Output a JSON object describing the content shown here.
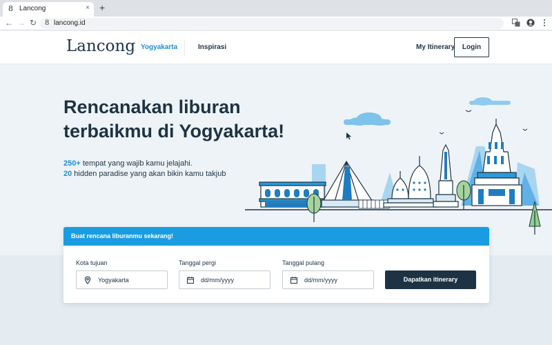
{
  "browser": {
    "tab_title": "Lancong",
    "tab_favicon": "8",
    "tab_close": "×",
    "new_tab": "+",
    "url": "lancong.id",
    "url_icon": "8",
    "back_icon": "←",
    "forward_icon": "→",
    "reload_icon": "↻",
    "extension_icons": [
      "translate-icon",
      "profile-avatar-icon",
      "more-vertical-icon"
    ]
  },
  "header": {
    "logo": "Lancong",
    "nav": [
      {
        "label": "Yogyakarta",
        "active": true
      },
      {
        "label": "Inspirasi",
        "active": false
      }
    ],
    "itinerary_link": "My Itinerary",
    "login_label": "Login"
  },
  "hero": {
    "headline_line1": "Rencanakan liburan",
    "headline_line2": "terbaikmu di Yogyakarta!",
    "stat1_number": "250+",
    "stat1_text": " tempat yang wajib kamu jelajahi.",
    "stat2_number": "20",
    "stat2_text": " hidden paradise yang akan bikin kamu takjub"
  },
  "planner": {
    "title": "Buat rencana liburanmu sekarang!",
    "destination_label": "Kota tujuan",
    "destination_value": "Yogyakarta",
    "depart_label": "Tanggal pergi",
    "depart_placeholder": "dd/mm/yyyy",
    "return_label": "Tanggal pulang",
    "return_placeholder": "dd/mm/yyyy",
    "submit_label": "Dapatkan itinerary"
  },
  "colors": {
    "brand_dark": "#1d3343",
    "brand_blue": "#1a9de0",
    "accent_link": "#1e8fd6",
    "page_bg": "#eef3f7"
  }
}
